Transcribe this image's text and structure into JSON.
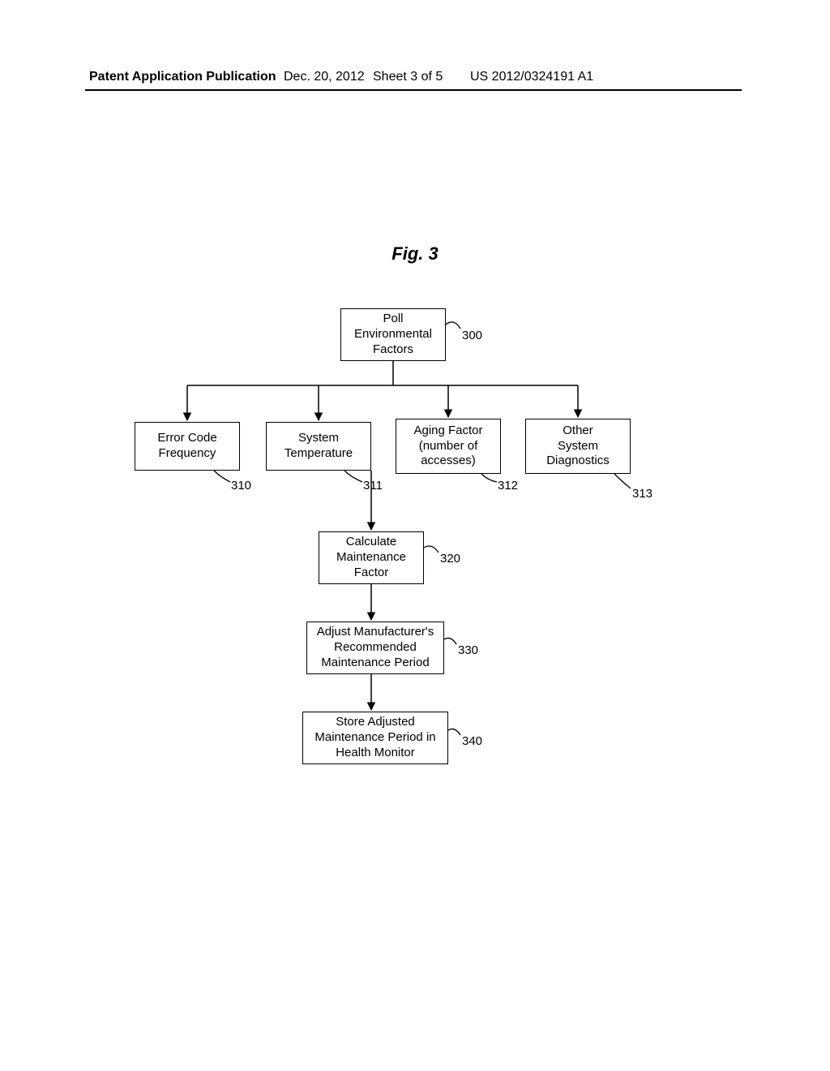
{
  "header": {
    "pub_type": "Patent Application Publication",
    "date": "Dec. 20, 2012",
    "sheet": "Sheet 3 of 5",
    "pub_number": "US 2012/0324191 A1"
  },
  "figure_label": "Fig. 3",
  "boxes": {
    "poll": {
      "text": "Poll\nEnvironmental\nFactors",
      "ref": "300"
    },
    "err": {
      "text": "Error Code\nFrequency",
      "ref": "310"
    },
    "temp": {
      "text": "System\nTemperature",
      "ref": "311"
    },
    "age": {
      "text": "Aging Factor\n(number of\naccesses)",
      "ref": "312"
    },
    "diag": {
      "text": "Other\nSystem\nDiagnostics",
      "ref": "313"
    },
    "calc": {
      "text": "Calculate\nMaintenance\nFactor",
      "ref": "320"
    },
    "adj": {
      "text": "Adjust Manufacturer's\nRecommended\nMaintenance Period",
      "ref": "330"
    },
    "store": {
      "text": "Store Adjusted\nMaintenance Period in\nHealth Monitor",
      "ref": "340"
    }
  }
}
